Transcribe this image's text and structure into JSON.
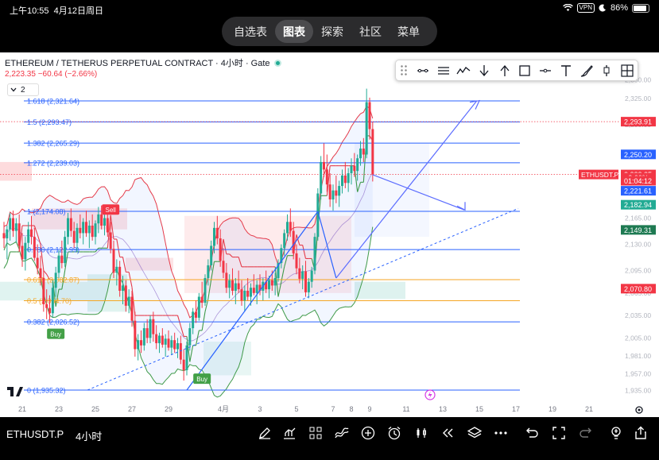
{
  "status_bar": {
    "time": "上午10:55",
    "date": "4月12日周日",
    "vpn": "VPN",
    "battery": "86%"
  },
  "tabs": [
    {
      "label": "自选表",
      "active": false
    },
    {
      "label": "图表",
      "active": true
    },
    {
      "label": "探索",
      "active": false
    },
    {
      "label": "社区",
      "active": false
    },
    {
      "label": "菜单",
      "active": false
    }
  ],
  "header": {
    "title": "ETHEREUM / TETHERUS PERPETUAL CONTRACT · 4小时 · Gate",
    "price_line": "2,223.35  −60.64 (−2.66%)",
    "indicator_count": "2"
  },
  "drawing_tools": [
    "trend-line-icon",
    "parallel-channel-icon",
    "path-icon",
    "arrow-down-icon",
    "arrow-up-icon",
    "rectangle-icon",
    "horizontal-ray-icon",
    "text-icon",
    "brush-icon",
    "long-position-icon",
    "crosshair-grid-icon"
  ],
  "watermark": "ETHUSDT.P · Gate",
  "colors": {
    "up": "#22ab94",
    "down": "#f23645",
    "blue": "#2962ff",
    "fib_orange": "#f5a623",
    "fib_green": "#4caf50",
    "bollinger_red": "#e53b4a",
    "bollinger_green": "#3f9a49",
    "supertrend_red": "#f8a5ad",
    "supertrend_green": "#9ad7a2"
  },
  "chart_data": {
    "type": "candlestick",
    "symbol": "ETHUSDT.P",
    "interval": "4小时",
    "ylim": [
      1925,
      2345
    ],
    "x_ticks": [
      "21",
      "23",
      "25",
      "27",
      "29",
      "4月",
      "3",
      "5",
      "7",
      "8",
      "9",
      "11",
      "13",
      "15",
      "17",
      "19",
      "21"
    ],
    "x_tick_dates": [
      "03-21",
      "03-23",
      "03-25",
      "03-27",
      "03-29",
      "04-01",
      "04-03",
      "04-05",
      "04-07",
      "04-08",
      "04-09",
      "04-11",
      "04-13",
      "04-15",
      "04-17",
      "04-19",
      "04-21"
    ],
    "y_ticks": [
      "2,350.00",
      "2,325.00",
      "2,290.00",
      "2,250.00",
      "2,200.00",
      "2,165.00",
      "2,130.00",
      "2,095.00",
      "2,065.00",
      "2,035.00",
      "2,005.00",
      "1,981.00",
      "1,957.00",
      "1,935.00"
    ],
    "fib_levels": [
      {
        "label": "1.618 (2,321.64)",
        "ratio": 1.618,
        "price": 2321.64,
        "color": "#2962ff"
      },
      {
        "label": "1.5 (2,293.47)",
        "ratio": 1.5,
        "price": 2293.47,
        "color": "#2962ff"
      },
      {
        "label": "1.382 (2,265.29)",
        "ratio": 1.382,
        "price": 2265.29,
        "color": "#2962ff"
      },
      {
        "label": "1.272 (2,239.03)",
        "ratio": 1.272,
        "price": 2239.03,
        "color": "#2962ff"
      },
      {
        "label": "1 (2,174.08)",
        "ratio": 1,
        "price": 2174.08,
        "color": "#2962ff"
      },
      {
        "label": "0.786 (2,122.99)",
        "ratio": 0.786,
        "price": 2122.99,
        "color": "#2962ff"
      },
      {
        "label": "0.618 (2,082.87)",
        "ratio": 0.618,
        "price": 2082.87,
        "color": "#f5a623"
      },
      {
        "label": "0.5 (2,054.70)",
        "ratio": 0.5,
        "price": 2054.7,
        "color": "#f5a623"
      },
      {
        "label": "0.382 (2,026.52)",
        "ratio": 0.382,
        "price": 2026.52,
        "color": "#2962ff"
      },
      {
        "label": "0 (1,935.32)",
        "ratio": 0,
        "price": 1935.32,
        "color": "#2962ff"
      }
    ],
    "price_labels": [
      {
        "text": "2,293.91",
        "price": 2293.91,
        "color": "#f23645"
      },
      {
        "text": "2,250.20",
        "price": 2250.2,
        "color": "#2962ff"
      },
      {
        "text": "2,223.35",
        "price": 2223.35,
        "color": "#f23645"
      },
      {
        "text": "+2.66%",
        "price": 2219,
        "color": "#f23645"
      },
      {
        "text": "01:04:12",
        "price": 2215,
        "color": "#f23645"
      },
      {
        "text": "2,221.61",
        "price": 2201.6,
        "color": "#2962ff"
      },
      {
        "text": "2,182.94",
        "price": 2182.94,
        "color": "#22ab94"
      },
      {
        "text": "2,149.31",
        "price": 2149.31,
        "color": "#1e7a52"
      },
      {
        "text": "2,070.80",
        "price": 2070.8,
        "color": "#f23645"
      }
    ],
    "last_price_tag": "ETHUSDT.P",
    "signals": [
      {
        "text": "Sell",
        "date": "03-25 20:00",
        "price": 2176,
        "color": "#f23645"
      },
      {
        "text": "Buy",
        "date": "03-22 20:00",
        "price": 2010,
        "color": "#43a047"
      },
      {
        "text": "Buy",
        "date": "03-30 20:00",
        "price": 1950,
        "color": "#43a047"
      }
    ],
    "candles_ohlc": [
      [
        "03-20 00:00",
        2145,
        2160,
        2125,
        2138
      ],
      [
        "03-20 04:00",
        2138,
        2155,
        2110,
        2150
      ],
      [
        "03-20 08:00",
        2150,
        2172,
        2135,
        2165
      ],
      [
        "03-20 12:00",
        2165,
        2175,
        2140,
        2148
      ],
      [
        "03-20 16:00",
        2148,
        2165,
        2132,
        2158
      ],
      [
        "03-20 20:00",
        2158,
        2170,
        2120,
        2128
      ],
      [
        "03-21 00:00",
        2128,
        2145,
        2100,
        2110
      ],
      [
        "03-21 04:00",
        2110,
        2140,
        2095,
        2132
      ],
      [
        "03-21 08:00",
        2132,
        2160,
        2120,
        2150
      ],
      [
        "03-21 12:00",
        2150,
        2168,
        2130,
        2140
      ],
      [
        "03-21 16:00",
        2140,
        2152,
        2108,
        2112
      ],
      [
        "03-21 20:00",
        2112,
        2130,
        2090,
        2098
      ],
      [
        "03-22 00:00",
        2098,
        2115,
        2075,
        2085
      ],
      [
        "03-22 04:00",
        2085,
        2095,
        2040,
        2050
      ],
      [
        "03-22 08:00",
        2050,
        2070,
        2030,
        2045
      ],
      [
        "03-22 12:00",
        2045,
        2062,
        2025,
        2038
      ],
      [
        "03-22 16:00",
        2038,
        2080,
        2032,
        2072
      ],
      [
        "03-22 20:00",
        2072,
        2100,
        2060,
        2092
      ],
      [
        "03-23 00:00",
        2092,
        2122,
        2085,
        2115
      ],
      [
        "03-23 04:00",
        2115,
        2135,
        2098,
        2105
      ],
      [
        "03-23 08:00",
        2105,
        2148,
        2100,
        2140
      ],
      [
        "03-23 12:00",
        2140,
        2172,
        2130,
        2165
      ],
      [
        "03-23 16:00",
        2165,
        2178,
        2140,
        2148
      ],
      [
        "03-23 20:00",
        2148,
        2160,
        2125,
        2132
      ],
      [
        "03-24 00:00",
        2132,
        2158,
        2120,
        2152
      ],
      [
        "03-24 04:00",
        2152,
        2170,
        2138,
        2145
      ],
      [
        "03-24 08:00",
        2145,
        2165,
        2130,
        2160
      ],
      [
        "03-24 12:00",
        2160,
        2175,
        2140,
        2145
      ],
      [
        "03-24 16:00",
        2145,
        2162,
        2125,
        2155
      ],
      [
        "03-24 20:00",
        2155,
        2170,
        2135,
        2140
      ],
      [
        "03-25 00:00",
        2140,
        2162,
        2130,
        2158
      ],
      [
        "03-25 04:00",
        2158,
        2180,
        2145,
        2170
      ],
      [
        "03-25 08:00",
        2170,
        2182,
        2150,
        2155
      ],
      [
        "03-25 12:00",
        2155,
        2172,
        2142,
        2165
      ],
      [
        "03-25 16:00",
        2165,
        2178,
        2140,
        2146
      ],
      [
        "03-25 20:00",
        2146,
        2160,
        2118,
        2124
      ],
      [
        "03-26 00:00",
        2124,
        2135,
        2085,
        2092
      ],
      [
        "03-26 04:00",
        2092,
        2110,
        2075,
        2100
      ],
      [
        "03-26 08:00",
        2100,
        2108,
        2060,
        2068
      ],
      [
        "03-26 12:00",
        2068,
        2088,
        2050,
        2075
      ],
      [
        "03-26 16:00",
        2075,
        2082,
        2040,
        2048
      ],
      [
        "03-26 20:00",
        2048,
        2070,
        2038,
        2060
      ],
      [
        "03-27 00:00",
        2060,
        2068,
        2020,
        2028
      ],
      [
        "03-27 04:00",
        2028,
        2040,
        1980,
        1990
      ],
      [
        "03-27 08:00",
        1990,
        2010,
        1975,
        2002
      ],
      [
        "03-27 12:00",
        2002,
        2015,
        1985,
        1995
      ],
      [
        "03-27 16:00",
        1995,
        2025,
        1988,
        2018
      ],
      [
        "03-27 20:00",
        2018,
        2030,
        1998,
        2005
      ],
      [
        "03-28 00:00",
        2005,
        2035,
        1998,
        2030
      ],
      [
        "03-28 04:00",
        2030,
        2040,
        2000,
        2010
      ],
      [
        "03-28 08:00",
        2010,
        2022,
        1990,
        1998
      ],
      [
        "03-28 12:00",
        1998,
        2012,
        1985,
        2008
      ],
      [
        "03-28 16:00",
        2008,
        2018,
        1992,
        1996
      ],
      [
        "03-28 20:00",
        1996,
        2010,
        1980,
        2004
      ],
      [
        "03-29 00:00",
        2004,
        2015,
        1988,
        1992
      ],
      [
        "03-29 04:00",
        1992,
        2008,
        1982,
        2002
      ],
      [
        "03-29 08:00",
        2002,
        2012,
        1985,
        1990
      ],
      [
        "03-29 12:00",
        1990,
        2005,
        1978,
        1998
      ],
      [
        "03-29 16:00",
        1998,
        2008,
        1970,
        1976
      ],
      [
        "03-29 20:00",
        1976,
        1990,
        1948,
        1962
      ],
      [
        "03-30 00:00",
        1962,
        2000,
        1955,
        1995
      ],
      [
        "03-30 04:00",
        1995,
        2025,
        1988,
        2018
      ],
      [
        "03-30 08:00",
        2018,
        2045,
        2010,
        2040
      ],
      [
        "03-30 12:00",
        2040,
        2055,
        2025,
        2032
      ],
      [
        "03-30 16:00",
        2032,
        2065,
        2028,
        2060
      ],
      [
        "03-30 20:00",
        2060,
        2080,
        2045,
        2052
      ],
      [
        "03-31 00:00",
        2052,
        2090,
        2048,
        2085
      ],
      [
        "03-31 04:00",
        2085,
        2110,
        2075,
        2102
      ],
      [
        "03-31 08:00",
        2102,
        2135,
        2095,
        2128
      ],
      [
        "03-31 12:00",
        2128,
        2160,
        2118,
        2152
      ],
      [
        "03-31 16:00",
        2152,
        2168,
        2130,
        2138
      ],
      [
        "03-31 20:00",
        2138,
        2150,
        2100,
        2108
      ],
      [
        "04-01 00:00",
        2108,
        2125,
        2085,
        2092
      ],
      [
        "04-01 04:00",
        2092,
        2105,
        2065,
        2072
      ],
      [
        "04-01 08:00",
        2072,
        2090,
        2058,
        2082
      ],
      [
        "04-01 12:00",
        2082,
        2098,
        2062,
        2068
      ],
      [
        "04-01 16:00",
        2068,
        2085,
        2050,
        2078
      ],
      [
        "04-01 20:00",
        2078,
        2095,
        2065,
        2070
      ],
      [
        "04-02 00:00",
        2070,
        2082,
        2048,
        2055
      ],
      [
        "04-02 04:00",
        2055,
        2075,
        2040,
        2068
      ],
      [
        "04-02 08:00",
        2068,
        2085,
        2055,
        2060
      ],
      [
        "04-02 12:00",
        2060,
        2078,
        2048,
        2072
      ],
      [
        "04-02 16:00",
        2072,
        2090,
        2062,
        2065
      ],
      [
        "04-02 20:00",
        2065,
        2082,
        2050,
        2076
      ],
      [
        "04-03 00:00",
        2076,
        2090,
        2062,
        2068
      ],
      [
        "04-03 04:00",
        2068,
        2085,
        2055,
        2080
      ],
      [
        "04-03 08:00",
        2080,
        2095,
        2065,
        2070
      ],
      [
        "04-03 12:00",
        2070,
        2088,
        2058,
        2082
      ],
      [
        "04-03 16:00",
        2082,
        2095,
        2068,
        2075
      ],
      [
        "04-03 20:00",
        2075,
        2092,
        2062,
        2085
      ],
      [
        "04-04 00:00",
        2085,
        2110,
        2080,
        2105
      ],
      [
        "04-04 04:00",
        2105,
        2130,
        2098,
        2125
      ],
      [
        "04-04 08:00",
        2125,
        2150,
        2115,
        2145
      ],
      [
        "04-04 12:00",
        2145,
        2170,
        2135,
        2160
      ],
      [
        "04-04 16:00",
        2160,
        2178,
        2140,
        2148
      ],
      [
        "04-04 20:00",
        2148,
        2160,
        2110,
        2118
      ],
      [
        "04-05 00:00",
        2118,
        2130,
        2090,
        2098
      ],
      [
        "04-05 04:00",
        2098,
        2112,
        2078,
        2084
      ],
      [
        "04-05 08:00",
        2084,
        2102,
        2070,
        2094
      ],
      [
        "04-05 12:00",
        2094,
        2108,
        2060,
        2066
      ],
      [
        "04-05 16:00",
        2066,
        2085,
        2058,
        2080
      ],
      [
        "04-05 20:00",
        2080,
        2100,
        2072,
        2095
      ],
      [
        "04-06 00:00",
        2095,
        2145,
        2090,
        2140
      ],
      [
        "04-06 04:00",
        2140,
        2205,
        2135,
        2198
      ],
      [
        "04-06 08:00",
        2198,
        2248,
        2190,
        2240
      ],
      [
        "04-06 12:00",
        2240,
        2265,
        2220,
        2230
      ],
      [
        "04-06 16:00",
        2230,
        2250,
        2200,
        2210
      ],
      [
        "04-06 20:00",
        2210,
        2225,
        2180,
        2190
      ],
      [
        "04-07 00:00",
        2190,
        2210,
        2175,
        2202
      ],
      [
        "04-07 04:00",
        2202,
        2222,
        2185,
        2195
      ],
      [
        "04-07 08:00",
        2195,
        2215,
        2180,
        2208
      ],
      [
        "04-07 12:00",
        2208,
        2230,
        2198,
        2222
      ],
      [
        "04-07 16:00",
        2222,
        2240,
        2205,
        2212
      ],
      [
        "04-07 20:00",
        2212,
        2232,
        2200,
        2225
      ],
      [
        "04-08 00:00",
        2225,
        2245,
        2210,
        2235
      ],
      [
        "04-08 04:00",
        2235,
        2252,
        2220,
        2228
      ],
      [
        "04-08 08:00",
        2228,
        2250,
        2215,
        2245
      ],
      [
        "04-08 12:00",
        2245,
        2268,
        2235,
        2258
      ],
      [
        "04-08 16:00",
        2258,
        2272,
        2240,
        2250
      ],
      [
        "04-08 20:00",
        2250,
        2338,
        2245,
        2320
      ],
      [
        "04-09 00:00",
        2320,
        2326,
        2270,
        2284
      ],
      [
        "04-09 04:00",
        2284,
        2294,
        2214,
        2223.35
      ]
    ]
  }
}
